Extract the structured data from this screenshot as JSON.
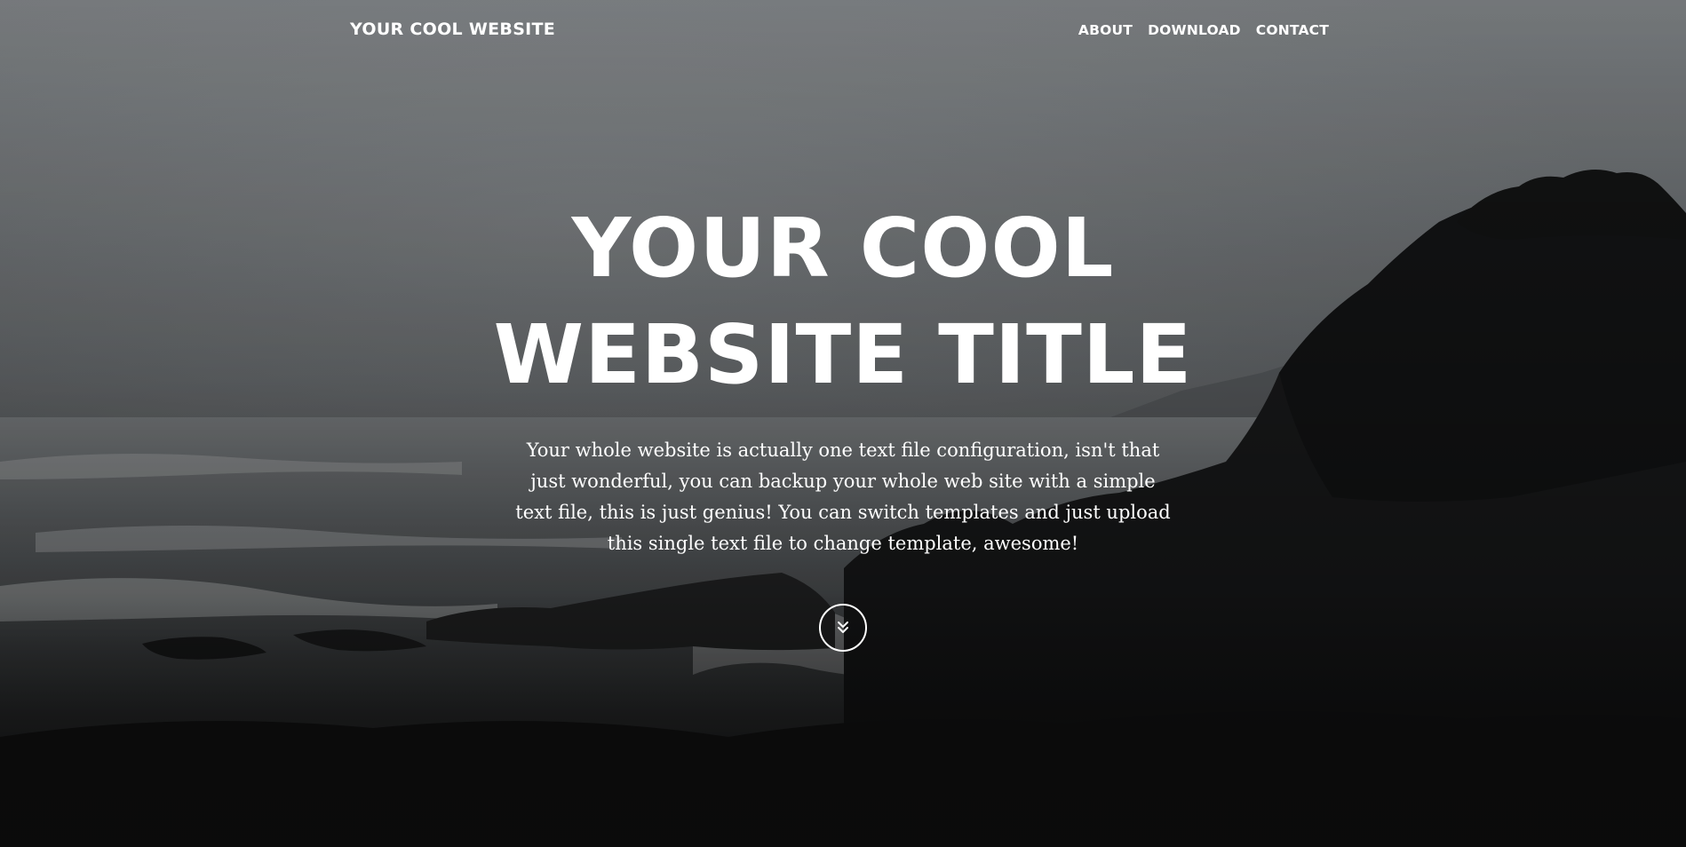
{
  "navbar": {
    "brand": "YOUR COOL WEBSITE",
    "links": [
      {
        "label": "ABOUT"
      },
      {
        "label": "DOWNLOAD"
      },
      {
        "label": "CONTACT"
      }
    ]
  },
  "hero": {
    "title_line_1": "YOUR COOL",
    "title_line_2": "WEBSITE TITLE",
    "description": "Your whole website is actually one text file configuration, isn't that just wonderful, you can backup your whole web site with a simple text file, this is just genius! You can switch templates and just upload this single text file to change template, awesome!",
    "scroll_icon": "double-chevron-down-icon",
    "background": "black-and-white photo of a rocky coastline with crashing waves under a foggy sky"
  }
}
